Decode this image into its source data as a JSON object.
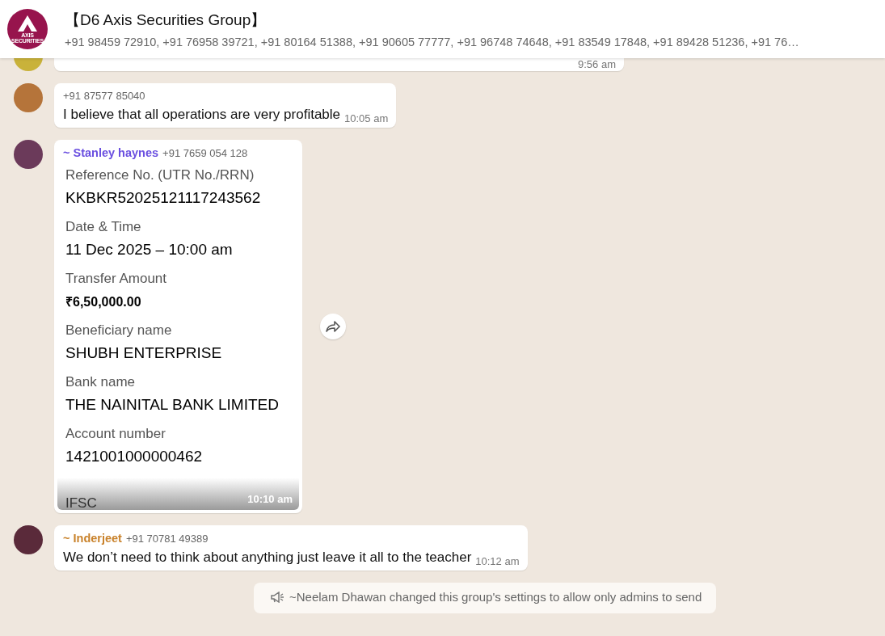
{
  "header": {
    "logo_text": "AXIS SECURITIES",
    "title": "【D6 Axis Securities Group】",
    "subtitle": "+91 98459 72910, +91 76958 39721, +91 80164 51388, +91 90605 77777, +91 96748 74648, +91 83549 17848, +91 89428 51236, +91 76…"
  },
  "messages": [
    {
      "kind": "cut",
      "time": "9:56 am"
    },
    {
      "kind": "text",
      "phone": "+91 87577 85040",
      "text": "I believe that all operations are very profitable",
      "time": "10:05 am"
    },
    {
      "kind": "receipt",
      "sender": "~ Stanley haynes",
      "color": "#6a4fe0",
      "phone": "+91 7659 054 128",
      "fields": [
        {
          "label": "Reference No. (UTR No./RRN)",
          "value": "KKBKR52025121117243562"
        },
        {
          "label": "Date & Time",
          "value": "11 Dec 2025 – 10:00 am"
        },
        {
          "label": "Transfer Amount",
          "value": "₹6,50,000.00"
        },
        {
          "label": "Beneficiary name",
          "value": "SHUBH ENTERPRISE"
        },
        {
          "label": "Bank name",
          "value": "THE NAINITAL BANK LIMITED"
        },
        {
          "label": "Account number",
          "value": "1421001000000462"
        }
      ],
      "cut_label": "IFSC",
      "time": "10:10 am"
    },
    {
      "kind": "text",
      "sender": "~ Inderjeet",
      "color": "#c9822b",
      "phone": "+91 70781 49389",
      "text": "We don’t need to think about anything  just leave it all to the teacher",
      "time": "10:12 am"
    }
  ],
  "system_message": "~Neelam Dhawan changed this group's settings to allow only admins to send"
}
